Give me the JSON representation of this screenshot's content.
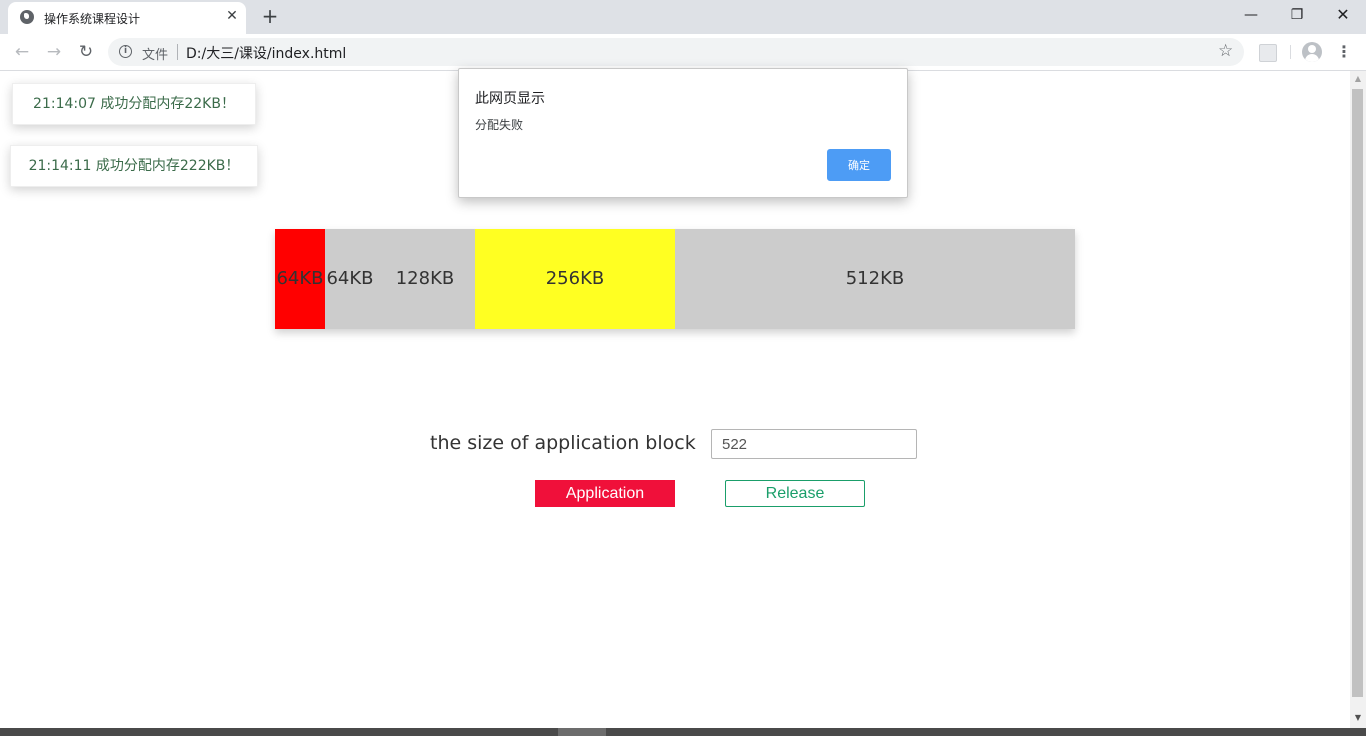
{
  "browser": {
    "tab_title": "操作系统课程设计",
    "tab_close": "✕",
    "new_tab": "+",
    "window_min": "—",
    "window_max": "❐",
    "window_close": "✕",
    "nav_back": "←",
    "nav_forward": "→",
    "nav_reload": "↻",
    "info_glyph": "i",
    "scheme_label": "文件",
    "url": "D:/大三/课设/index.html",
    "star": "☆",
    "menu": "⋮"
  },
  "notifications": [
    "21:14:07 成功分配内存22KB！",
    "21:14:11 成功分配内存222KB！"
  ],
  "memory_blocks": [
    {
      "label": "64KB",
      "size": 64,
      "color": "#ff0000",
      "state": "allocated"
    },
    {
      "label": "64KB",
      "size": 64,
      "color": "#cccccc",
      "state": "free"
    },
    {
      "label": "128KB",
      "size": 128,
      "color": "#cccccc",
      "state": "free"
    },
    {
      "label": "256KB",
      "size": 256,
      "color": "#ffff22",
      "state": "allocated"
    },
    {
      "label": "512KB",
      "size": 512,
      "color": "#cccccc",
      "state": "free"
    }
  ],
  "form": {
    "size_label": "the size of application block",
    "size_value": "522",
    "application_label": "Application",
    "release_label": "Release"
  },
  "alert": {
    "title": "此网页显示",
    "message": "分配失败",
    "ok_label": "确定"
  },
  "colors": {
    "application_button": "#f0103a",
    "release_button": "#1a9e6a",
    "dialog_ok": "#4d9cf5"
  }
}
